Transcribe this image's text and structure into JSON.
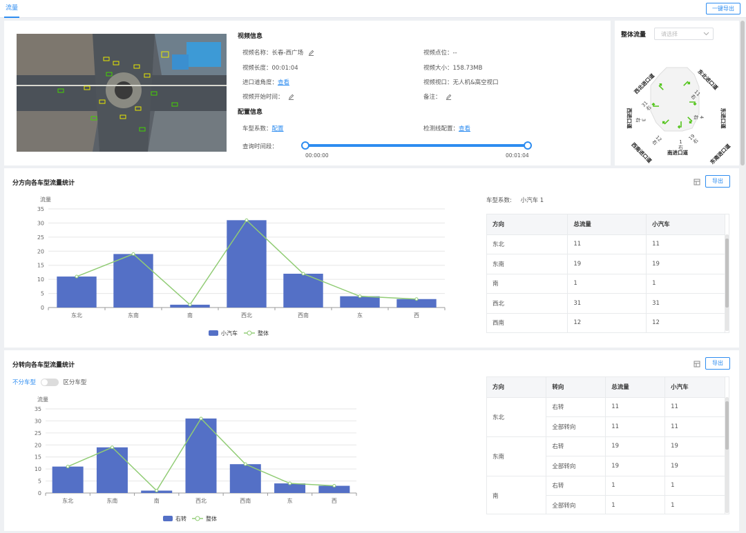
{
  "tabs": {
    "active": "流量"
  },
  "header": {
    "export_all": "一键导出"
  },
  "video_info": {
    "section_title": "视频信息",
    "name_label": "视频名称：",
    "name_value": "长春-西广场",
    "point_label": "视频点位：",
    "point_value": "--",
    "length_label": "视频长度：",
    "length_value": "00:01:04",
    "size_label": "视频大小：",
    "size_value": "158.73MB",
    "angle_label": "进口道角度：",
    "angle_link": "查看",
    "viewpoint_label": "视频视口：",
    "viewpoint_value": "无人机&高空视口",
    "start_label": "视频开始时间：",
    "note_label": "备注："
  },
  "config_info": {
    "section_title": "配置信息",
    "coef_label": "车型系数：",
    "coef_link": "配置",
    "line_label": "检测线配置：",
    "line_link": "查看",
    "range_label": "查询时间段：",
    "range_start": "00:00:00",
    "range_end": "00:01:04",
    "range_fraction": [
      0,
      1
    ]
  },
  "overall_flow": {
    "title": "整体流量",
    "select_placeholder": "请选择",
    "approaches": [
      {
        "label": "西北进口道",
        "count": "31",
        "turn": "右"
      },
      {
        "label": "东北进口道",
        "count": "11",
        "turn": "右"
      },
      {
        "label": "东进口道",
        "count": "4",
        "turn": "右"
      },
      {
        "label": "东南进口道",
        "count": "19",
        "turn": "右"
      },
      {
        "label": "南进口道",
        "count": "1",
        "turn": "右"
      },
      {
        "label": "西南进口道",
        "count": "12",
        "turn": "右"
      },
      {
        "label": "西进口道",
        "count": "3",
        "turn": "右"
      }
    ],
    "accent_color": "#52c41a"
  },
  "direction_section": {
    "title": "分方向各车型流量统计",
    "export_label": "导出",
    "coef_label": "车型系数:",
    "coef_value": "小汽车 1",
    "table": {
      "columns": [
        "方向",
        "总流量",
        "小汽车"
      ],
      "rows": [
        [
          "东北",
          "11",
          "11"
        ],
        [
          "东南",
          "19",
          "19"
        ],
        [
          "南",
          "1",
          "1"
        ],
        [
          "西北",
          "31",
          "31"
        ],
        [
          "西南",
          "12",
          "12"
        ]
      ]
    }
  },
  "turn_section": {
    "title": "分转向各车型流量统计",
    "export_label": "导出",
    "toggle_off_label": "不分车型",
    "toggle_on_label": "区分车型",
    "table": {
      "columns": [
        "方向",
        "转向",
        "总流量",
        "小汽车"
      ],
      "groups": [
        {
          "direction": "东北",
          "rows": [
            [
              "右转",
              "11",
              "11"
            ],
            [
              "全部转向",
              "11",
              "11"
            ]
          ]
        },
        {
          "direction": "东南",
          "rows": [
            [
              "右转",
              "19",
              "19"
            ],
            [
              "全部转向",
              "19",
              "19"
            ]
          ]
        },
        {
          "direction": "南",
          "rows": [
            [
              "右转",
              "1",
              "1"
            ],
            [
              "全部转向",
              "1",
              "1"
            ]
          ]
        }
      ]
    }
  },
  "chart_data": [
    {
      "type": "bar",
      "ylabel": "流量",
      "categories": [
        "东北",
        "东南",
        "南",
        "西北",
        "西南",
        "东",
        "西"
      ],
      "ylim": [
        0,
        35
      ],
      "yticks": [
        0,
        5,
        10,
        15,
        20,
        25,
        30,
        35
      ],
      "series": [
        {
          "name": "小汽车",
          "type": "bar",
          "values": [
            11,
            19,
            1,
            31,
            12,
            4,
            3
          ],
          "color": "#5470c6"
        },
        {
          "name": "整体",
          "type": "line",
          "values": [
            11,
            19,
            1,
            31,
            12,
            4,
            3
          ],
          "color": "#91cc75"
        }
      ],
      "legend": "bottom-center",
      "grid": true
    },
    {
      "type": "bar",
      "ylabel": "流量",
      "categories": [
        "东北",
        "东南",
        "南",
        "西北",
        "西南",
        "东",
        "西"
      ],
      "ylim": [
        0,
        35
      ],
      "yticks": [
        0,
        5,
        10,
        15,
        20,
        25,
        30,
        35
      ],
      "series": [
        {
          "name": "右转",
          "type": "bar",
          "values": [
            11,
            19,
            1,
            31,
            12,
            4,
            3
          ],
          "color": "#5470c6"
        },
        {
          "name": "整体",
          "type": "line",
          "values": [
            11,
            19,
            1,
            31,
            12,
            4,
            3
          ],
          "color": "#91cc75"
        }
      ],
      "legend": "bottom-center",
      "grid": true
    }
  ]
}
